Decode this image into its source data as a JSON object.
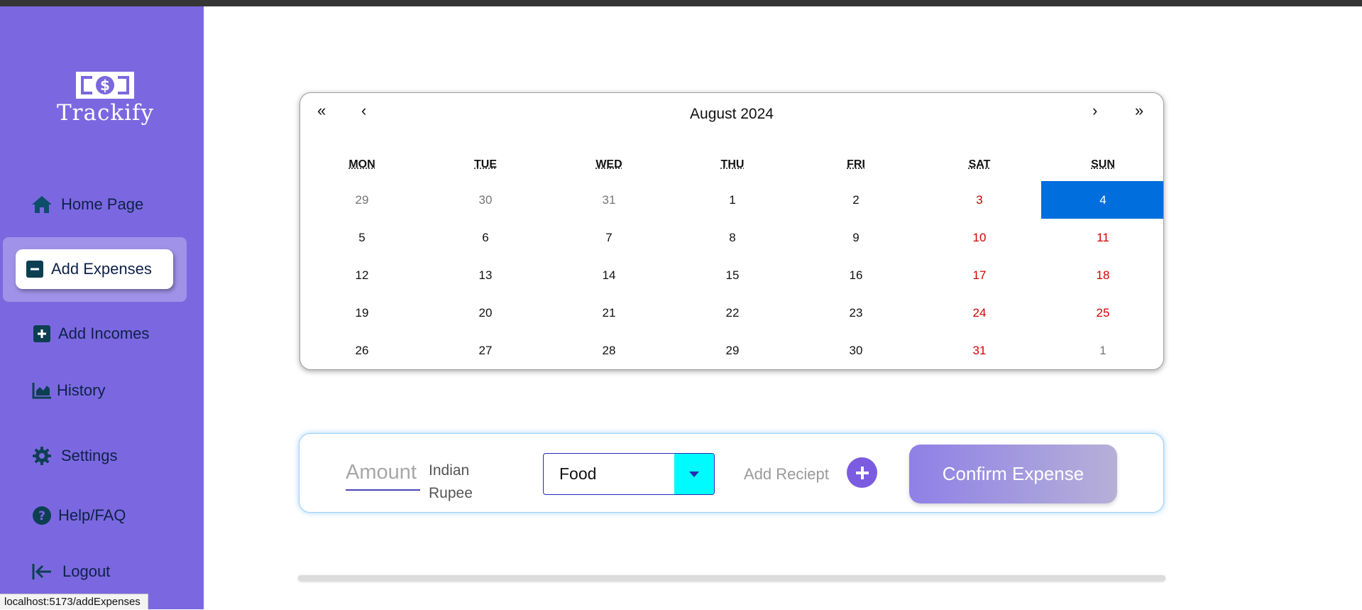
{
  "app": {
    "name": "Trackify"
  },
  "sidebar": {
    "items": [
      {
        "label": "Home Page",
        "icon": "home-icon"
      },
      {
        "label": "Add Expenses",
        "icon": "minus-square-icon",
        "active": true
      },
      {
        "label": "Add Incomes",
        "icon": "plus-square-icon"
      },
      {
        "label": "History",
        "icon": "chart-area-icon"
      },
      {
        "label": "Settings",
        "icon": "gear-icon"
      },
      {
        "label": "Help/FAQ",
        "icon": "question-circle-icon"
      },
      {
        "label": "Logout",
        "icon": "logout-icon"
      }
    ]
  },
  "calendar": {
    "nav": {
      "prev_year": "«",
      "prev_month": "‹",
      "next_month": "›",
      "next_year": "»"
    },
    "title": "August 2024",
    "weekdays": [
      "MON",
      "TUE",
      "WED",
      "THU",
      "FRI",
      "SAT",
      "SUN"
    ],
    "days": [
      [
        "29",
        "30",
        "31",
        "1",
        "2",
        "3",
        "4"
      ],
      [
        "5",
        "6",
        "7",
        "8",
        "9",
        "10",
        "11"
      ],
      [
        "12",
        "13",
        "14",
        "15",
        "16",
        "17",
        "18"
      ],
      [
        "19",
        "20",
        "21",
        "22",
        "23",
        "24",
        "25"
      ],
      [
        "26",
        "27",
        "28",
        "29",
        "30",
        "31",
        "1"
      ]
    ],
    "selected_day": "4"
  },
  "expense_form": {
    "amount_placeholder": "Amount",
    "currency_label": "Indian Rupee",
    "category_value": "Food",
    "receipt_label": "Add Reciept",
    "confirm_label": "Confirm Expense"
  },
  "status_bar": {
    "url": "localhost:5173/addExpenses"
  },
  "colors": {
    "sidebar_bg": "#7b68e0",
    "selected_day_bg": "#006edc",
    "weekend_text": "#d10000",
    "dropdown_arrow_bg": "#00fbff",
    "nav_text": "#0d2148"
  }
}
